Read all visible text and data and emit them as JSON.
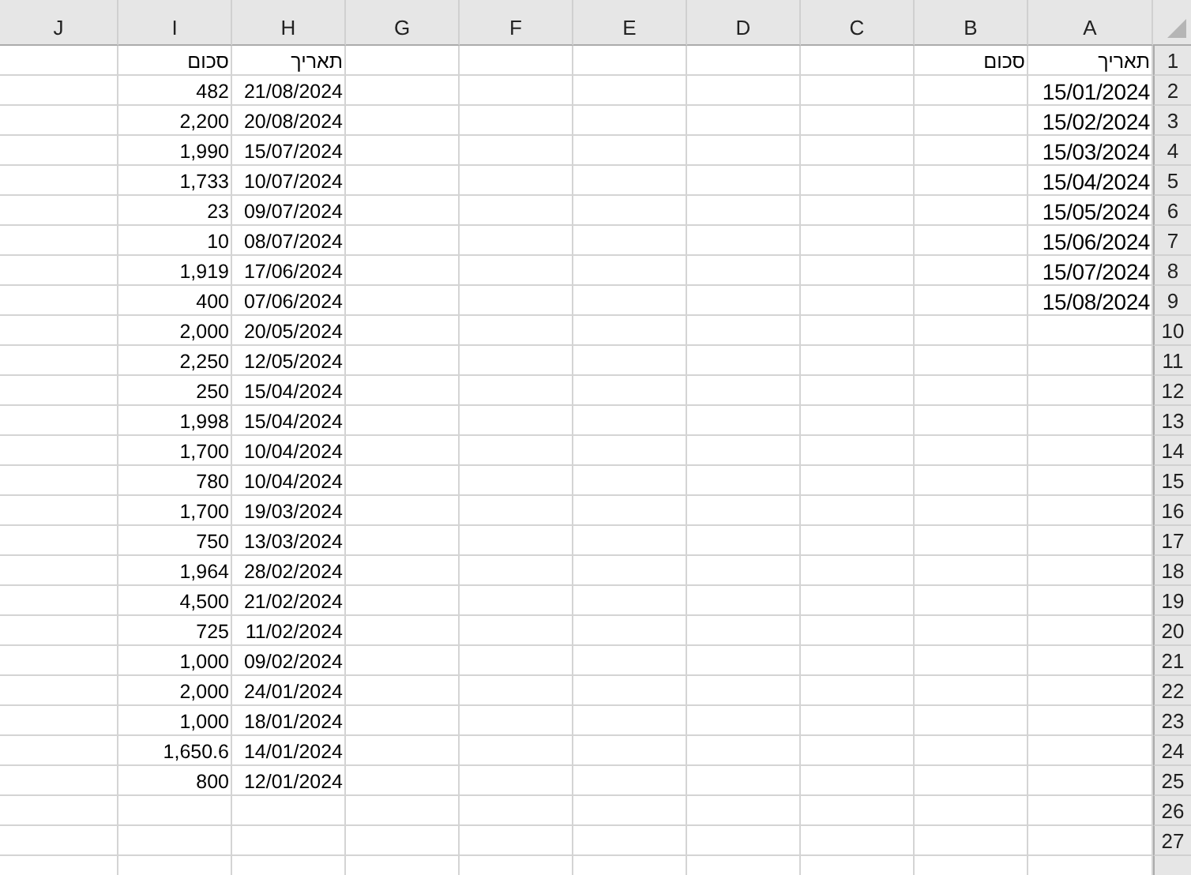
{
  "columns": [
    {
      "letter": "J"
    },
    {
      "letter": "I",
      "cells": [
        {
          "text": "סכום",
          "kind": "plain"
        },
        {
          "text": "482",
          "kind": "plain"
        },
        {
          "text": "2,200",
          "kind": "plain"
        },
        {
          "text": "1,990",
          "kind": "plain"
        },
        {
          "text": "1,733",
          "kind": "plain"
        },
        {
          "text": "23",
          "kind": "plain"
        },
        {
          "text": "10",
          "kind": "plain"
        },
        {
          "text": "1,919",
          "kind": "plain"
        },
        {
          "text": "400",
          "kind": "plain"
        },
        {
          "text": "2,000",
          "kind": "plain"
        },
        {
          "text": "2,250",
          "kind": "plain"
        },
        {
          "text": "250",
          "kind": "plain"
        },
        {
          "text": "1,998",
          "kind": "plain"
        },
        {
          "text": "1,700",
          "kind": "plain"
        },
        {
          "text": "780",
          "kind": "plain"
        },
        {
          "text": "1,700",
          "kind": "plain"
        },
        {
          "text": "750",
          "kind": "plain"
        },
        {
          "text": "1,964",
          "kind": "plain"
        },
        {
          "text": "4,500",
          "kind": "plain"
        },
        {
          "text": "725",
          "kind": "plain"
        },
        {
          "text": "1,000",
          "kind": "plain"
        },
        {
          "text": "2,000",
          "kind": "plain"
        },
        {
          "text": "1,000",
          "kind": "plain"
        },
        {
          "text": "1,650.6",
          "kind": "plain"
        },
        {
          "text": "800",
          "kind": "plain"
        }
      ]
    },
    {
      "letter": "H",
      "cells": [
        {
          "text": "תאריך",
          "kind": "plain"
        },
        {
          "text": "21/08/2024",
          "kind": "plain"
        },
        {
          "text": "20/08/2024",
          "kind": "plain"
        },
        {
          "text": "15/07/2024",
          "kind": "plain"
        },
        {
          "text": "10/07/2024",
          "kind": "plain"
        },
        {
          "text": "09/07/2024",
          "kind": "plain"
        },
        {
          "text": "08/07/2024",
          "kind": "plain"
        },
        {
          "text": "17/06/2024",
          "kind": "plain"
        },
        {
          "text": "07/06/2024",
          "kind": "plain"
        },
        {
          "text": "20/05/2024",
          "kind": "plain"
        },
        {
          "text": "12/05/2024",
          "kind": "plain"
        },
        {
          "text": "15/04/2024",
          "kind": "plain"
        },
        {
          "text": "15/04/2024",
          "kind": "plain"
        },
        {
          "text": "10/04/2024",
          "kind": "plain"
        },
        {
          "text": "10/04/2024",
          "kind": "plain"
        },
        {
          "text": "19/03/2024",
          "kind": "plain"
        },
        {
          "text": "13/03/2024",
          "kind": "plain"
        },
        {
          "text": "28/02/2024",
          "kind": "plain"
        },
        {
          "text": "21/02/2024",
          "kind": "plain"
        },
        {
          "text": "11/02/2024",
          "kind": "plain"
        },
        {
          "text": "09/02/2024",
          "kind": "plain"
        },
        {
          "text": "24/01/2024",
          "kind": "plain"
        },
        {
          "text": "18/01/2024",
          "kind": "plain"
        },
        {
          "text": "14/01/2024",
          "kind": "plain"
        },
        {
          "text": "12/01/2024",
          "kind": "plain"
        }
      ]
    },
    {
      "letter": "G"
    },
    {
      "letter": "F"
    },
    {
      "letter": "E"
    },
    {
      "letter": "D"
    },
    {
      "letter": "C"
    },
    {
      "letter": "B",
      "cells": [
        {
          "text": "סכום",
          "kind": "plain"
        }
      ]
    },
    {
      "letter": "A",
      "cells": [
        {
          "text": "תאריך",
          "kind": "plain"
        },
        {
          "text": "15/01/2024",
          "kind": "big"
        },
        {
          "text": "15/02/2024",
          "kind": "big"
        },
        {
          "text": "15/03/2024",
          "kind": "big"
        },
        {
          "text": "15/04/2024",
          "kind": "big"
        },
        {
          "text": "15/05/2024",
          "kind": "big"
        },
        {
          "text": "15/06/2024",
          "kind": "big"
        },
        {
          "text": "15/07/2024",
          "kind": "big"
        },
        {
          "text": "15/08/2024",
          "kind": "big"
        }
      ]
    }
  ],
  "row_numbers": [
    "1",
    "2",
    "3",
    "4",
    "5",
    "6",
    "7",
    "8",
    "9",
    "10",
    "11",
    "12",
    "13",
    "14",
    "15",
    "16",
    "17",
    "18",
    "19",
    "20",
    "21",
    "22",
    "23",
    "24",
    "25",
    "26",
    "27"
  ]
}
